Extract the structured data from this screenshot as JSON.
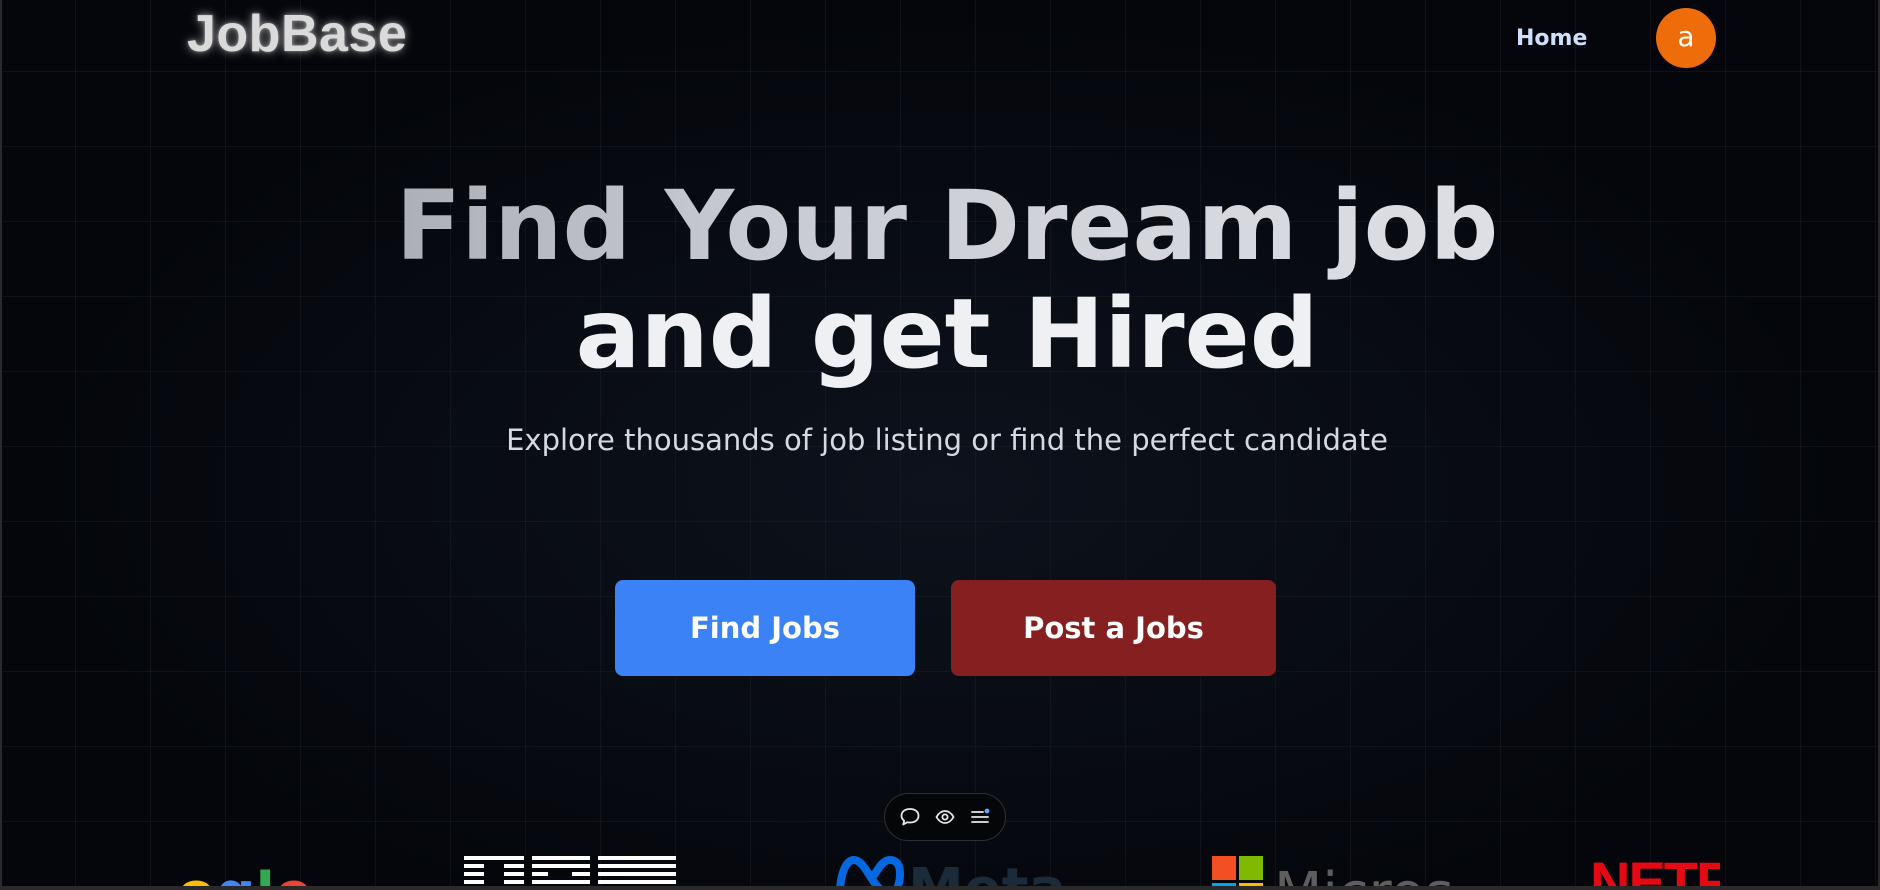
{
  "header": {
    "logo": "JobBase",
    "nav": {
      "home_label": "Home"
    },
    "avatar_initial": "a"
  },
  "hero": {
    "title_line1": "Find Your Dream job",
    "title_line2": "and get Hired",
    "subtitle": "Explore thousands of job listing or find the perfect candidate"
  },
  "actions": {
    "find_jobs_label": "Find Jobs",
    "post_jobs_label": "Post a Jobs"
  },
  "toolbar": {
    "icons": [
      "chat-bubble-icon",
      "eye-icon",
      "menu-list-icon"
    ]
  },
  "companies": [
    {
      "name": "Google",
      "color": "#4285f4"
    },
    {
      "name": "IBM",
      "color": "#ffffff"
    },
    {
      "name": "Meta",
      "color": "#0668e1"
    },
    {
      "name": "Microsoft",
      "color": "#737373"
    },
    {
      "name": "Netflix",
      "color": "#e50914"
    }
  ],
  "colors": {
    "background": "#04060b",
    "find_button": "#3b82f6",
    "post_button": "#861f1f",
    "avatar": "#ef6c0a",
    "nav_link": "#cfe0ff"
  }
}
